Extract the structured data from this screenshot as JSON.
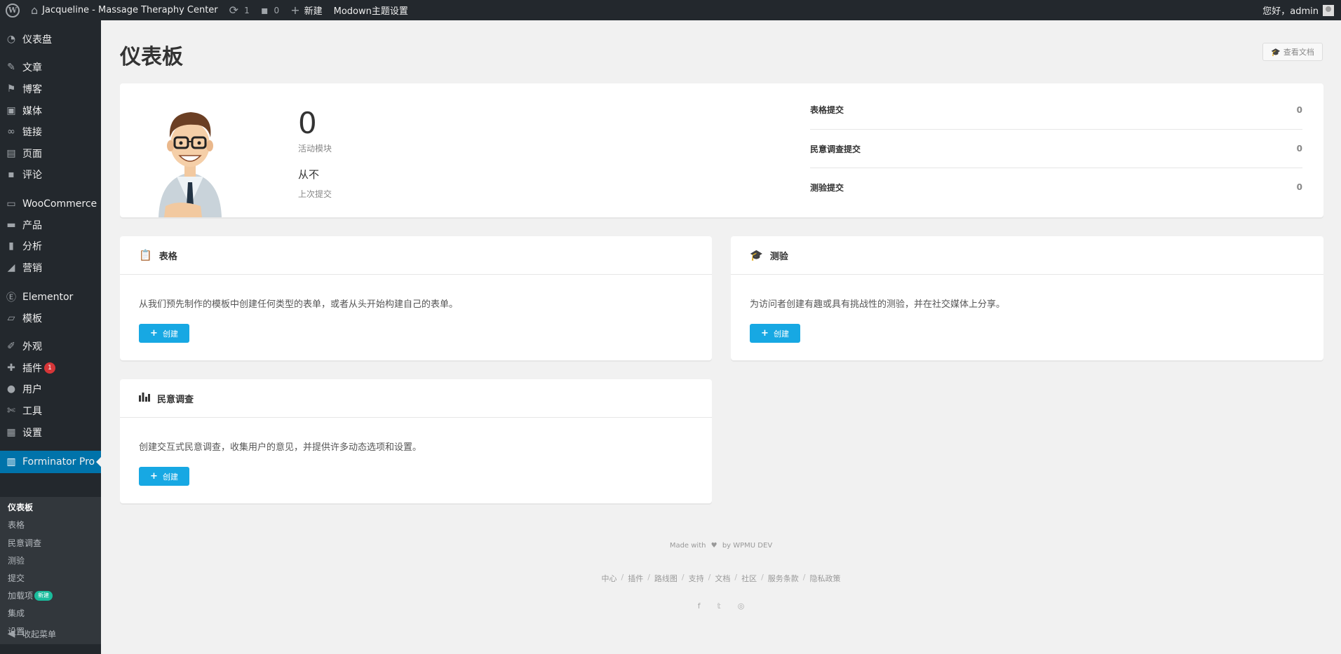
{
  "adminbar": {
    "logo_icon": "wordpress-icon",
    "site_name": "Jacqueline - Massage Theraphy Center",
    "updates_count": "1",
    "comments_count": "0",
    "new_label": "新建",
    "theme_settings": "Modown主题设置",
    "greeting": "您好，admin"
  },
  "sidebar": {
    "items": [
      {
        "label": "仪表盘",
        "icon": "dashboard-icon"
      },
      {
        "label": "文章",
        "icon": "pin-icon"
      },
      {
        "label": "博客",
        "icon": "flag-icon"
      },
      {
        "label": "媒体",
        "icon": "media-icon"
      },
      {
        "label": "链接",
        "icon": "link-icon"
      },
      {
        "label": "页面",
        "icon": "page-icon"
      },
      {
        "label": "评论",
        "icon": "comment-icon"
      },
      {
        "label": "WooCommerce",
        "icon": "woo-icon"
      },
      {
        "label": "产品",
        "icon": "archive-icon"
      },
      {
        "label": "分析",
        "icon": "bar-chart-icon"
      },
      {
        "label": "营销",
        "icon": "megaphone-icon"
      },
      {
        "label": "Elementor",
        "icon": "elementor-icon"
      },
      {
        "label": "模板",
        "icon": "folder-icon"
      },
      {
        "label": "外观",
        "icon": "brush-icon"
      },
      {
        "label": "插件",
        "icon": "plugin-icon",
        "badge": "1"
      },
      {
        "label": "用户",
        "icon": "user-icon"
      },
      {
        "label": "工具",
        "icon": "wrench-icon"
      },
      {
        "label": "设置",
        "icon": "settings-icon"
      },
      {
        "label": "Forminator Pro",
        "icon": "clipboard-icon"
      }
    ],
    "submenu": [
      {
        "label": "仪表板"
      },
      {
        "label": "表格"
      },
      {
        "label": "民意调查"
      },
      {
        "label": "测验"
      },
      {
        "label": "提交"
      },
      {
        "label": "加载项",
        "badge": "新建"
      },
      {
        "label": "集成"
      },
      {
        "label": "设置"
      }
    ],
    "collapse_label": "收起菜单"
  },
  "main": {
    "title": "仪表板",
    "docs_button": "查看文档",
    "summary": {
      "active_modules_value": "0",
      "active_modules_label": "活动模块",
      "last_submission_value": "从不",
      "last_submission_label": "上次提交",
      "stats": [
        {
          "name": "表格提交",
          "value": "0"
        },
        {
          "name": "民意调查提交",
          "value": "0"
        },
        {
          "name": "测验提交",
          "value": "0"
        }
      ]
    },
    "modules": {
      "forms": {
        "title": "表格",
        "icon": "clipboard-icon",
        "description": "从我们预先制作的模板中创建任何类型的表单，或者从头开始构建自己的表单。",
        "button": "创建"
      },
      "quizzes": {
        "title": "测验",
        "icon": "graduation-cap-icon",
        "description": "为访问者创建有趣或具有挑战性的测验，并在社交媒体上分享。",
        "button": "创建"
      },
      "polls": {
        "title": "民意调查",
        "icon": "poll-icon",
        "description": "创建交互式民意调查，收集用户的意见，并提供许多动态选项和设置。",
        "button": "创建"
      }
    }
  },
  "footer": {
    "made_with": "Made with",
    "by": "by WPMU DEV",
    "links": [
      "中心",
      "插件",
      "路线图",
      "支持",
      "文档",
      "社区",
      "服务条款",
      "隐私政策"
    ],
    "social": [
      "facebook-icon",
      "twitter-icon",
      "instagram-icon"
    ]
  },
  "colors": {
    "adminbar_bg": "#23282d",
    "sidebar_current": "#0073aa",
    "button_blue": "#17a8e3",
    "badge_red": "#d63638",
    "badge_green": "#1abc9c"
  }
}
